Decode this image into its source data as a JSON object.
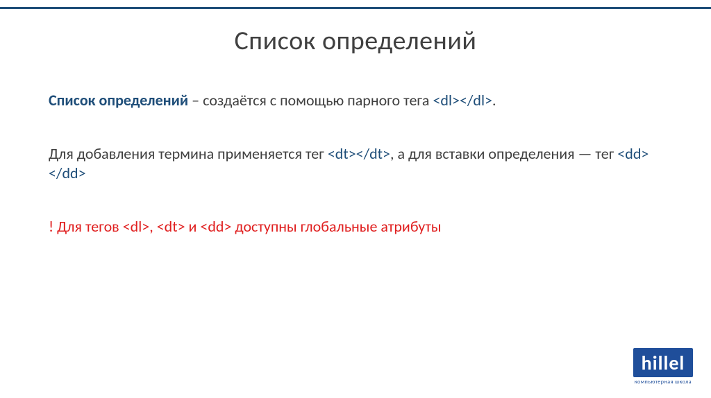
{
  "title": "Список определений",
  "p1": {
    "term": "Список определений",
    "rest_before_code": " – создаётся с помощью парного тега ",
    "code": "<dl></dl>",
    "rest_after_code": "."
  },
  "p2": {
    "t1": "Для добавления термина применяется тег ",
    "c1": "<dt></dt>",
    "t2": ", а для вставки определения — тег ",
    "c2": "<dd></dd>"
  },
  "p3": {
    "t1": "! Для тегов ",
    "c1": "<dl>",
    "t2": ", ",
    "c2": "<dt>",
    "t3": " и ",
    "c3": "<dd>",
    "t4": " доступны глобальные атрибуты"
  },
  "logo": {
    "brand": "hillel",
    "sub": "компьютерная школа"
  }
}
